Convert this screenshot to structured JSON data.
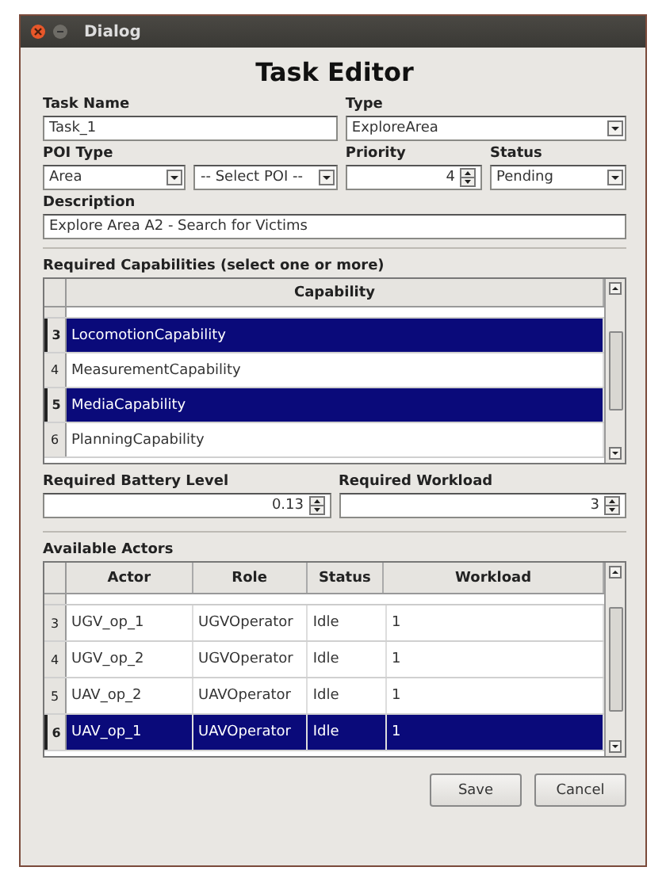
{
  "window": {
    "title": "Dialog"
  },
  "heading": "Task Editor",
  "task_name": {
    "label": "Task Name",
    "value": "Task_1"
  },
  "type": {
    "label": "Type",
    "value": "ExploreArea"
  },
  "poi_type": {
    "label": "POI Type",
    "value": "Area",
    "poi_value": "-- Select POI --"
  },
  "priority": {
    "label": "Priority",
    "value": "4"
  },
  "status": {
    "label": "Status",
    "value": "Pending"
  },
  "description": {
    "label": "Description",
    "value": "Explore Area A2 - Search for Victims"
  },
  "capabilities": {
    "label": "Required Capabilities (select one or more)",
    "column": "Capability",
    "rows": [
      {
        "number": "3",
        "name": "LocomotionCapability",
        "selected": true
      },
      {
        "number": "4",
        "name": "MeasurementCapability",
        "selected": false
      },
      {
        "number": "5",
        "name": "MediaCapability",
        "selected": true
      },
      {
        "number": "6",
        "name": "PlanningCapability",
        "selected": false
      }
    ]
  },
  "battery": {
    "label": "Required Battery Level",
    "value": "0.13"
  },
  "workload": {
    "label": "Required Workload",
    "value": "3"
  },
  "actors": {
    "label": "Available Actors",
    "columns": [
      "Actor",
      "Role",
      "Status",
      "Workload"
    ],
    "rows": [
      {
        "number": "3",
        "cells": [
          "UGV_op_1",
          "UGVOperator",
          "Idle",
          "1"
        ],
        "selected": false
      },
      {
        "number": "4",
        "cells": [
          "UGV_op_2",
          "UGVOperator",
          "Idle",
          "1"
        ],
        "selected": false
      },
      {
        "number": "5",
        "cells": [
          "UAV_op_2",
          "UAVOperator",
          "Idle",
          "1"
        ],
        "selected": false
      },
      {
        "number": "6",
        "cells": [
          "UAV_op_1",
          "UAVOperator",
          "Idle",
          "1"
        ],
        "selected": true
      }
    ]
  },
  "buttons": [
    "Save",
    "Cancel"
  ]
}
